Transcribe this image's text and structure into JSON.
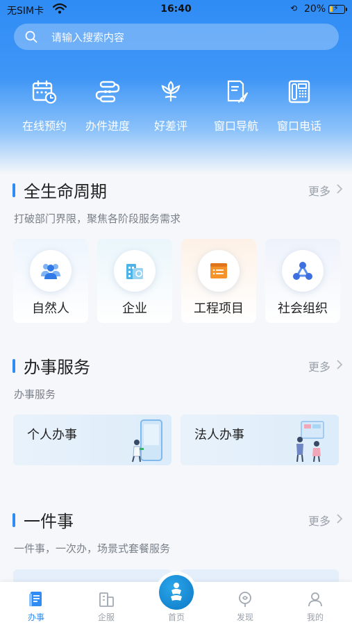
{
  "status_bar": {
    "carrier": "无SIM卡",
    "time": "16:40",
    "battery_percent": "20%",
    "battery_level": 0.2
  },
  "search": {
    "placeholder": "请输入搜索内容"
  },
  "quick_actions": [
    {
      "label": "在线预约",
      "icon": "calendar-clock-icon"
    },
    {
      "label": "办件进度",
      "icon": "progress-flow-icon"
    },
    {
      "label": "好差评",
      "icon": "rating-flower-icon"
    },
    {
      "label": "窗口导航",
      "icon": "navigation-doc-icon"
    },
    {
      "label": "窗口电话",
      "icon": "telephone-icon"
    }
  ],
  "lifecycle": {
    "title": "全生命周期",
    "more": "更多",
    "subtitle": "打破部门界限，聚焦各阶段服务需求",
    "items": [
      {
        "label": "自然人",
        "icon": "people-icon"
      },
      {
        "label": "企业",
        "icon": "enterprise-building-icon"
      },
      {
        "label": "工程项目",
        "icon": "project-document-icon"
      },
      {
        "label": "社会组织",
        "icon": "organization-network-icon"
      }
    ]
  },
  "services": {
    "title": "办事服务",
    "more": "更多",
    "subtitle": "办事服务",
    "items": [
      {
        "label": "个人办事"
      },
      {
        "label": "法人办事"
      }
    ]
  },
  "one_thing": {
    "title": "一件事",
    "more": "更多",
    "subtitle": "一件事，一次办，场景式套餐服务"
  },
  "tabbar": {
    "items": [
      {
        "label": "办事",
        "icon": "document-icon",
        "active": true
      },
      {
        "label": "企服",
        "icon": "building-icon",
        "active": false
      },
      {
        "label": "首页",
        "icon": "home-logo-icon",
        "active": false
      },
      {
        "label": "发现",
        "icon": "discover-icon",
        "active": false
      },
      {
        "label": "我的",
        "icon": "profile-icon",
        "active": false
      }
    ]
  },
  "colors": {
    "primary": "#2f8cf5",
    "text": "#222222",
    "muted": "#9aa1ab",
    "orange": "#f5922a"
  }
}
